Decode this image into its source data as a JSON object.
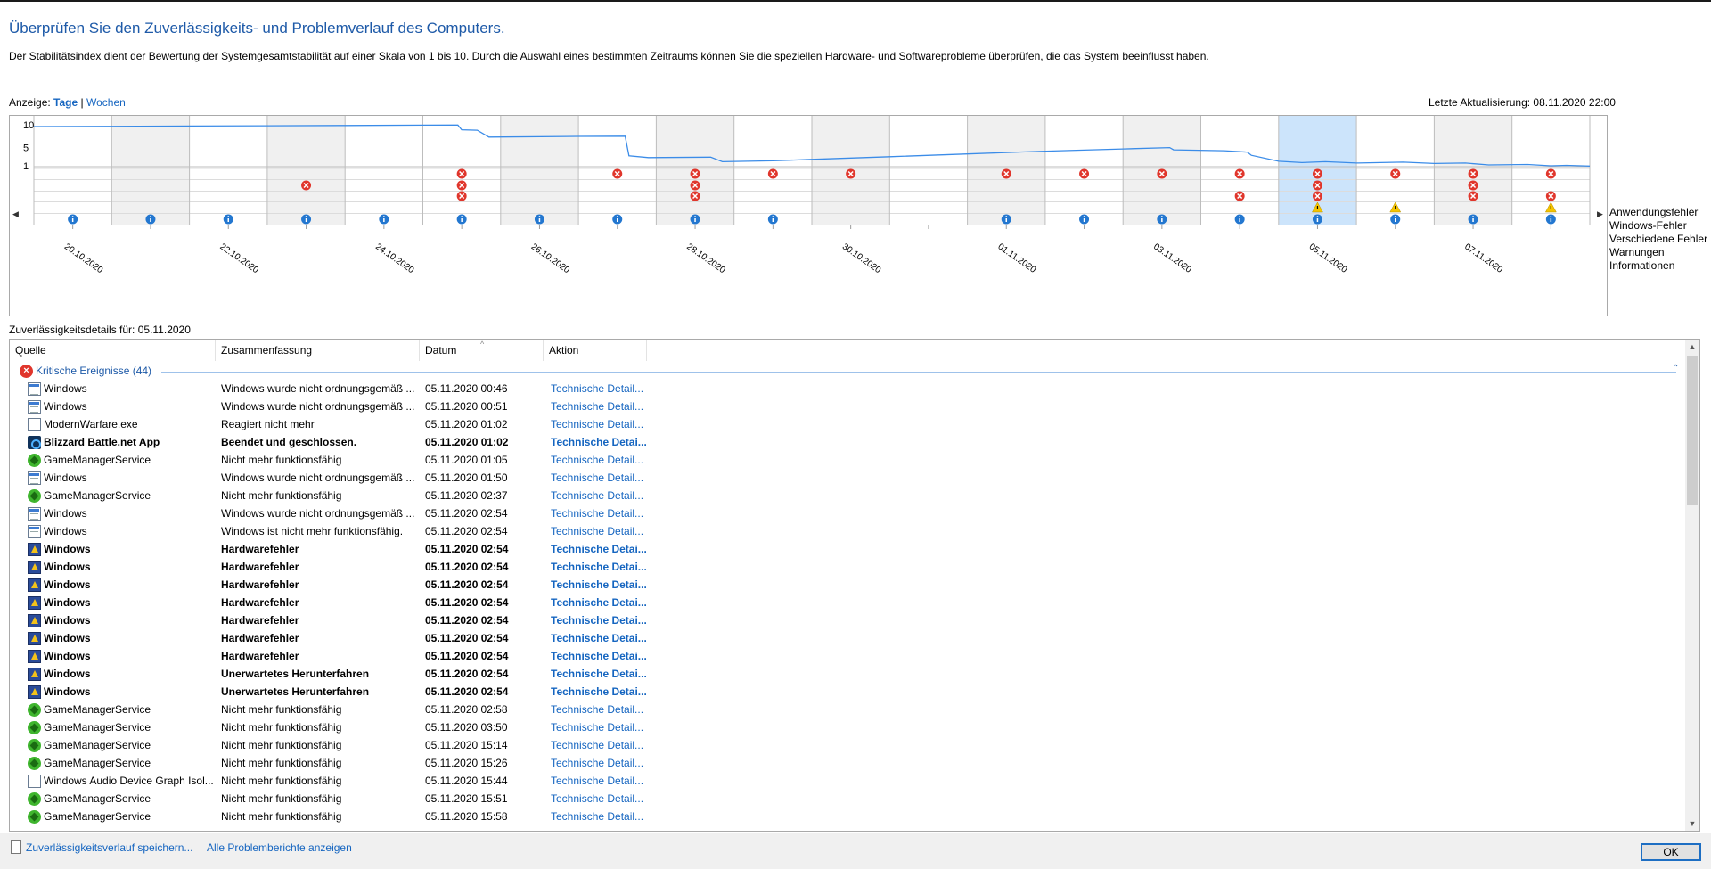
{
  "header": {
    "title": "Überprüfen Sie den Zuverlässigkeits- und Problemverlauf des Computers.",
    "description": "Der Stabilitätsindex dient der Bewertung der Systemgesamtstabilität auf einer Skala von 1 bis 10. Durch die Auswahl eines bestimmten Zeitraums können Sie die speziellen Hardware- und Softwareprobleme überprüfen, die das System beeinflusst haben."
  },
  "view": {
    "label": "Anzeige:",
    "days": "Tage",
    "separator": "|",
    "weeks": "Wochen",
    "last_update": "Letzte Aktualisierung: 08.11.2020 22:00"
  },
  "chart_data": {
    "type": "line",
    "y_ticks": [
      "10",
      "5",
      "1"
    ],
    "ylim": [
      1,
      10
    ],
    "columns": 20,
    "selected_column": 16,
    "date_labels": [
      "20.10.2020",
      "22.10.2020",
      "24.10.2020",
      "26.10.2020",
      "28.10.2020",
      "30.10.2020",
      "01.11.2020",
      "03.11.2020",
      "05.11.2020",
      "07.11.2020"
    ],
    "stability_index": [
      [
        0,
        9.6
      ],
      [
        1.0,
        9.65
      ],
      [
        2.0,
        9.72
      ],
      [
        3.0,
        9.78
      ],
      [
        4.0,
        9.85
      ],
      [
        5.0,
        9.92
      ],
      [
        5.45,
        9.95
      ],
      [
        5.5,
        8.9
      ],
      [
        5.7,
        8.8
      ],
      [
        5.85,
        7.3
      ],
      [
        7.0,
        7.45
      ],
      [
        7.6,
        7.5
      ],
      [
        7.65,
        3.2
      ],
      [
        7.9,
        2.8
      ],
      [
        8.7,
        2.9
      ],
      [
        8.85,
        1.9
      ],
      [
        9.5,
        2.1
      ],
      [
        10,
        2.4
      ],
      [
        11,
        3.0
      ],
      [
        12,
        3.6
      ],
      [
        13,
        4.2
      ],
      [
        14,
        4.7
      ],
      [
        14.6,
        5.0
      ],
      [
        14.65,
        4.5
      ],
      [
        15.3,
        4.3
      ],
      [
        15.6,
        4.0
      ],
      [
        15.65,
        3.3
      ],
      [
        16.0,
        2.0
      ],
      [
        16.3,
        1.7
      ],
      [
        16.6,
        1.9
      ],
      [
        17.0,
        1.6
      ],
      [
        17.6,
        1.8
      ],
      [
        18.0,
        1.5
      ],
      [
        18.4,
        1.6
      ],
      [
        18.7,
        1.2
      ],
      [
        19.2,
        1.3
      ],
      [
        19.5,
        1.0
      ],
      [
        19.7,
        1.1
      ],
      [
        20.0,
        0.95
      ]
    ],
    "categories": [
      "Anwendungsfehler",
      "Windows-Fehler",
      "Verschiedene Fehler",
      "Warnungen",
      "Informationen"
    ],
    "markers": {
      "Anwendungsfehler": [
        5,
        7,
        8,
        9,
        10,
        12,
        13,
        14,
        15,
        16,
        17,
        18,
        19
      ],
      "Windows-Fehler": [
        3,
        5,
        8,
        16,
        18
      ],
      "Verschiedene Fehler": [
        5,
        8,
        15,
        16,
        18,
        19
      ],
      "Warnungen": [
        16,
        17,
        19
      ],
      "Informationen": [
        0,
        1,
        2,
        3,
        4,
        5,
        6,
        7,
        8,
        9,
        12,
        13,
        14,
        15,
        16,
        17,
        18,
        19
      ]
    },
    "colors": {
      "line": "#3b8ce8",
      "selected": "#cce4fb",
      "shade": "#f0f0f0",
      "error": "#e0362c",
      "warning": "#f5c400",
      "info": "#2377d0"
    }
  },
  "details": {
    "label": "Zuverlässigkeitsdetails für: 05.11.2020",
    "columns": [
      "Quelle",
      "Zusammenfassung",
      "Datum",
      "Aktion"
    ],
    "group_label": "Kritische Ereignisse (44)",
    "rows": [
      {
        "icon": "win",
        "source": "Windows",
        "summary": "Windows wurde nicht ordnungsgemäß ...",
        "date": "05.11.2020 00:46",
        "action": "Technische Detail...",
        "bold": false
      },
      {
        "icon": "win",
        "source": "Windows",
        "summary": "Windows wurde nicht ordnungsgemäß ...",
        "date": "05.11.2020 00:51",
        "action": "Technische Detail...",
        "bold": false
      },
      {
        "icon": "app",
        "source": "ModernWarfare.exe",
        "summary": "Reagiert nicht mehr",
        "date": "05.11.2020 01:02",
        "action": "Technische Detail...",
        "bold": false
      },
      {
        "icon": "bnet",
        "source": "Blizzard Battle.net App",
        "summary": "Beendet und geschlossen.",
        "date": "05.11.2020 01:02",
        "action": "Technische Detai...",
        "bold": true
      },
      {
        "icon": "razer",
        "source": "GameManagerService",
        "summary": "Nicht mehr funktionsfähig",
        "date": "05.11.2020 01:05",
        "action": "Technische Detail...",
        "bold": false
      },
      {
        "icon": "win",
        "source": "Windows",
        "summary": "Windows wurde nicht ordnungsgemäß ...",
        "date": "05.11.2020 01:50",
        "action": "Technische Detail...",
        "bold": false
      },
      {
        "icon": "razer",
        "source": "GameManagerService",
        "summary": "Nicht mehr funktionsfähig",
        "date": "05.11.2020 02:37",
        "action": "Technische Detail...",
        "bold": false
      },
      {
        "icon": "win",
        "source": "Windows",
        "summary": "Windows wurde nicht ordnungsgemäß ...",
        "date": "05.11.2020 02:54",
        "action": "Technische Detail...",
        "bold": false
      },
      {
        "icon": "win",
        "source": "Windows",
        "summary": "Windows ist nicht mehr funktionsfähig.",
        "date": "05.11.2020 02:54",
        "action": "Technische Detail...",
        "bold": false
      },
      {
        "icon": "hw",
        "source": "Windows",
        "summary": "Hardwarefehler",
        "date": "05.11.2020 02:54",
        "action": "Technische Detai...",
        "bold": true
      },
      {
        "icon": "hw",
        "source": "Windows",
        "summary": "Hardwarefehler",
        "date": "05.11.2020 02:54",
        "action": "Technische Detai...",
        "bold": true
      },
      {
        "icon": "hw",
        "source": "Windows",
        "summary": "Hardwarefehler",
        "date": "05.11.2020 02:54",
        "action": "Technische Detai...",
        "bold": true
      },
      {
        "icon": "hw",
        "source": "Windows",
        "summary": "Hardwarefehler",
        "date": "05.11.2020 02:54",
        "action": "Technische Detai...",
        "bold": true
      },
      {
        "icon": "hw",
        "source": "Windows",
        "summary": "Hardwarefehler",
        "date": "05.11.2020 02:54",
        "action": "Technische Detai...",
        "bold": true
      },
      {
        "icon": "hw",
        "source": "Windows",
        "summary": "Hardwarefehler",
        "date": "05.11.2020 02:54",
        "action": "Technische Detai...",
        "bold": true
      },
      {
        "icon": "hw",
        "source": "Windows",
        "summary": "Hardwarefehler",
        "date": "05.11.2020 02:54",
        "action": "Technische Detai...",
        "bold": true
      },
      {
        "icon": "hw",
        "source": "Windows",
        "summary": "Unerwartetes Herunterfahren",
        "date": "05.11.2020 02:54",
        "action": "Technische Detai...",
        "bold": true
      },
      {
        "icon": "hw",
        "source": "Windows",
        "summary": "Unerwartetes Herunterfahren",
        "date": "05.11.2020 02:54",
        "action": "Technische Detai...",
        "bold": true
      },
      {
        "icon": "razer",
        "source": "GameManagerService",
        "summary": "Nicht mehr funktionsfähig",
        "date": "05.11.2020 02:58",
        "action": "Technische Detail...",
        "bold": false
      },
      {
        "icon": "razer",
        "source": "GameManagerService",
        "summary": "Nicht mehr funktionsfähig",
        "date": "05.11.2020 03:50",
        "action": "Technische Detail...",
        "bold": false
      },
      {
        "icon": "razer",
        "source": "GameManagerService",
        "summary": "Nicht mehr funktionsfähig",
        "date": "05.11.2020 15:14",
        "action": "Technische Detail...",
        "bold": false
      },
      {
        "icon": "razer",
        "source": "GameManagerService",
        "summary": "Nicht mehr funktionsfähig",
        "date": "05.11.2020 15:26",
        "action": "Technische Detail...",
        "bold": false
      },
      {
        "icon": "app",
        "source": "Windows Audio Device Graph Isol...",
        "summary": "Nicht mehr funktionsfähig",
        "date": "05.11.2020 15:44",
        "action": "Technische Detail...",
        "bold": false
      },
      {
        "icon": "razer",
        "source": "GameManagerService",
        "summary": "Nicht mehr funktionsfähig",
        "date": "05.11.2020 15:51",
        "action": "Technische Detail...",
        "bold": false
      },
      {
        "icon": "razer",
        "source": "GameManagerService",
        "summary": "Nicht mehr funktionsfähig",
        "date": "05.11.2020 15:58",
        "action": "Technische Detail...",
        "bold": false
      }
    ]
  },
  "footer": {
    "save_link": "Zuverlässigkeitsverlauf speichern...",
    "all_reports_link": "Alle Problemberichte anzeigen",
    "ok_button": "OK"
  }
}
